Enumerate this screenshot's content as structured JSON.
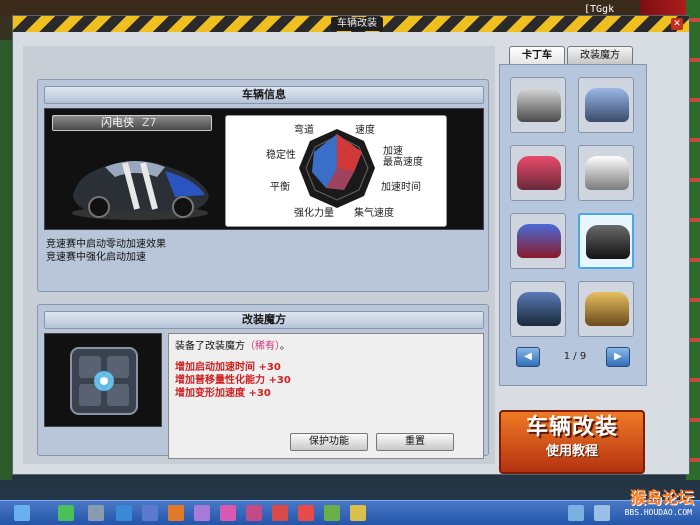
{
  "system": {
    "tray_text": "[TGgk"
  },
  "window": {
    "title": "车辆改装"
  },
  "vehicle_info": {
    "header": "车辆信息",
    "car_name": "闪电侠",
    "car_level": "Z7",
    "stats": [
      "弯道",
      "速度",
      "加速",
      "最高速度",
      "加速时间",
      "集气速度",
      "强化力量",
      "平衡",
      "稳定性"
    ],
    "description_lines": [
      "竞速赛中启动零动加速效果",
      "竞速赛中强化启动加速"
    ]
  },
  "magic": {
    "header": "改装魔方",
    "equipped_prefix": "装备了改装魔方",
    "equipped_name": "（稀有）",
    "equipped_suffix": "。",
    "effects": [
      "增加启动加速时间 +30",
      "增加普移量性化能力 +30",
      "增加变形加速度 +30"
    ],
    "protect_button": "保护功能",
    "reset_button": "重置"
  },
  "sidebar": {
    "tabs": [
      "卡丁车",
      "改装魔方"
    ],
    "page_indicator": "1 / 9",
    "tutorial_main": "车辆改装",
    "tutorial_sub": "使用教程"
  },
  "branding": {
    "forum_logo": "猴岛论坛",
    "forum_url": "BBS.HOUDAO.COM"
  }
}
